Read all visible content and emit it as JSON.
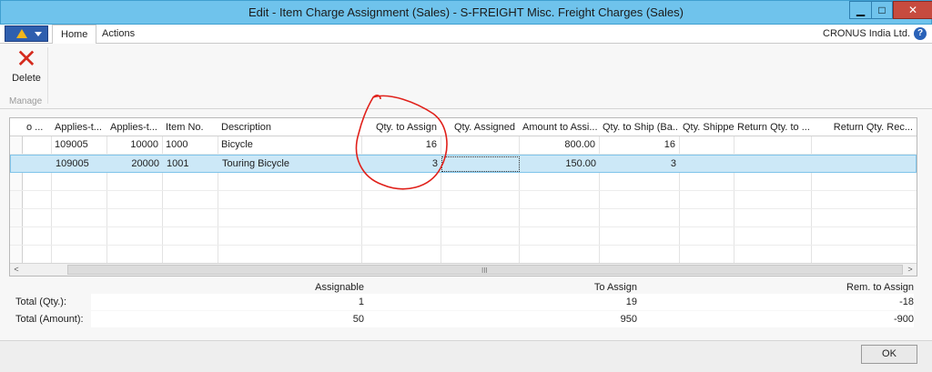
{
  "window": {
    "title": "Edit - Item Charge Assignment (Sales) - S-FREIGHT Misc. Freight Charges (Sales)",
    "min_glyph": "▁",
    "max_glyph": "□",
    "close_glyph": "✕"
  },
  "ribbon": {
    "tabs": [
      "Home",
      "Actions"
    ],
    "company": "CRONUS India Ltd.",
    "help_glyph": "?",
    "delete_label": "Delete",
    "group_label": "Manage"
  },
  "grid": {
    "columns": [
      "o ...",
      "Applies-t...",
      "Applies-t...",
      "Item No.",
      "Description",
      "Qty. to Assign",
      "Qty. Assigned",
      "Amount to Assi...",
      "Qty. to Ship (Ba...",
      "Qty. Shipped (B...",
      "Return Qty. to ...",
      "Return Qty. Rec..."
    ],
    "rows": [
      [
        "",
        "109005",
        "10000",
        "1000",
        "Bicycle",
        "16",
        "",
        "800.00",
        "16",
        "",
        "",
        ""
      ],
      [
        "",
        "109005",
        "20000",
        "1001",
        "Touring Bicycle",
        "3",
        "",
        "150.00",
        "3",
        "",
        "",
        ""
      ]
    ],
    "scroll_left": "<",
    "scroll_right": ">",
    "scroll_grip": "III"
  },
  "totals": {
    "headers": {
      "assignable": "Assignable",
      "to_assign": "To Assign",
      "rem_to_assign": "Rem. to Assign"
    },
    "qty": {
      "label": "Total (Qty.):",
      "assignable": "1",
      "to_assign": "19",
      "rem_to_assign": "-18"
    },
    "amount": {
      "label": "Total (Amount):",
      "assignable": "50",
      "to_assign": "950",
      "rem_to_assign": "-900"
    }
  },
  "footer": {
    "ok_label": "OK"
  },
  "colors": {
    "titlebar": "#6fc3ec",
    "selection": "#cce8f7",
    "annotation": "#e0201a"
  }
}
